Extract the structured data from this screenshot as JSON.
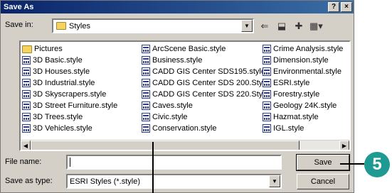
{
  "window": {
    "title": "Save As",
    "help_glyph": "?",
    "close_glyph": "×"
  },
  "save_in": {
    "label": "Save in:",
    "value": "Styles"
  },
  "toolbar_icons": [
    "back-icon",
    "up-folder-icon",
    "new-folder-icon",
    "view-menu-icon"
  ],
  "files": {
    "column1": [
      {
        "name": "Pictures",
        "icon": "folder"
      },
      {
        "name": "3D Basic.style",
        "icon": "style"
      },
      {
        "name": "3D Houses.style",
        "icon": "style"
      },
      {
        "name": "3D Industrial.style",
        "icon": "style"
      },
      {
        "name": "3D Skyscrapers.style",
        "icon": "style"
      },
      {
        "name": "3D Street Furniture.style",
        "icon": "style"
      },
      {
        "name": "3D Trees.style",
        "icon": "style"
      },
      {
        "name": "3D Vehicles.style",
        "icon": "style"
      }
    ],
    "column2": [
      {
        "name": "ArcScene Basic.style",
        "icon": "style"
      },
      {
        "name": "Business.style",
        "icon": "style"
      },
      {
        "name": "CADD GIS Center SDS195.style",
        "icon": "style"
      },
      {
        "name": "CADD GIS Center SDS 200.Style",
        "icon": "style"
      },
      {
        "name": "CADD GIS Center SDS 220.Style",
        "icon": "style"
      },
      {
        "name": "Caves.style",
        "icon": "style"
      },
      {
        "name": "Civic.style",
        "icon": "style"
      },
      {
        "name": "Conservation.style",
        "icon": "style"
      }
    ],
    "column3": [
      {
        "name": "Crime Analysis.style",
        "icon": "style"
      },
      {
        "name": "Dimension.style",
        "icon": "style"
      },
      {
        "name": "Environmental.style",
        "icon": "style"
      },
      {
        "name": "ESRI.style",
        "icon": "style"
      },
      {
        "name": "Forestry.style",
        "icon": "style"
      },
      {
        "name": "Geology 24K.style",
        "icon": "style"
      },
      {
        "name": "Hazmat.style",
        "icon": "style"
      },
      {
        "name": "IGL.style",
        "icon": "style"
      }
    ]
  },
  "file_name": {
    "label": "File name:",
    "value": ""
  },
  "save_as_type": {
    "label": "Save as type:",
    "value": "ESRI Styles (*.style)"
  },
  "buttons": {
    "save": "Save",
    "cancel": "Cancel"
  },
  "callout": {
    "number": "5",
    "color": "#1e9a92"
  }
}
